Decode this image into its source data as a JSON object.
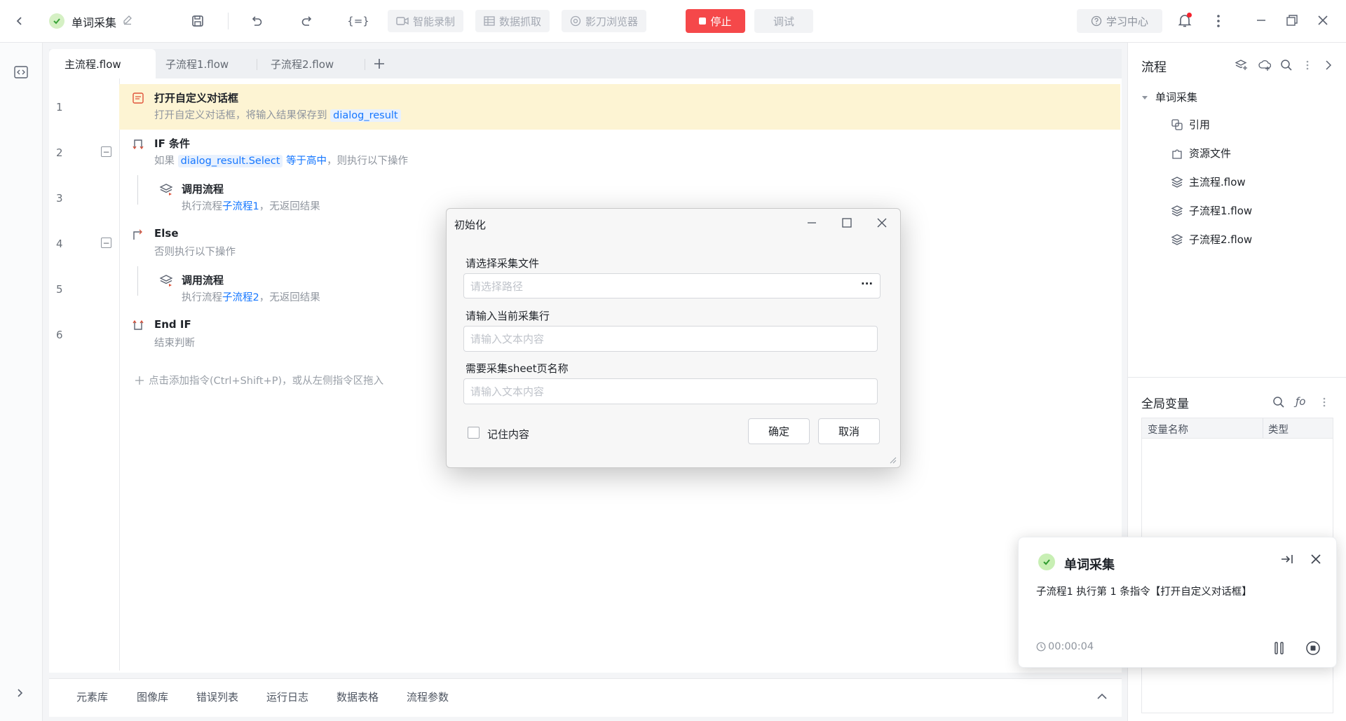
{
  "toolbar": {
    "project_name": "单词采集",
    "smart_record": "智能录制",
    "data_capture": "数据抓取",
    "browser": "影刀浏览器",
    "stop": "停止",
    "debug": "调试",
    "help_center": "学习中心"
  },
  "tabs": [
    {
      "label": "主流程.flow"
    },
    {
      "label": "子流程1.flow"
    },
    {
      "label": "子流程2.flow"
    }
  ],
  "steps": [
    {
      "line": "1",
      "title": "打开自定义对话框",
      "desc_prefix": "打开自定义对话框，将输入结果保存到",
      "var": "dialog_result"
    },
    {
      "line": "2",
      "title": "IF 条件",
      "desc_prefix": "如果",
      "var": "dialog_result.Select",
      "desc_mid": "等于高中",
      "desc_suffix": "，则执行以下操作"
    },
    {
      "line": "3",
      "title": "调用流程",
      "desc_prefix": "执行流程",
      "link": "子流程1",
      "desc_suffix": "，无返回结果"
    },
    {
      "line": "4",
      "title": "Else",
      "desc": "否则执行以下操作"
    },
    {
      "line": "5",
      "title": "调用流程",
      "desc_prefix": "执行流程",
      "link": "子流程2",
      "desc_suffix": "，无返回结果"
    },
    {
      "line": "6",
      "title": "End IF",
      "desc": "结束判断"
    }
  ],
  "add_hint": "点击添加指令(Ctrl+Shift+P)，或从左侧指令区拖入",
  "bottom_tabs": [
    "元素库",
    "图像库",
    "错误列表",
    "运行日志",
    "数据表格",
    "流程参数"
  ],
  "right_panel": {
    "title": "流程",
    "tree_root": "单词采集",
    "tree_items": [
      "引用",
      "资源文件",
      "主流程.flow",
      "子流程1.flow",
      "子流程2.flow"
    ],
    "vars_title": "全局变量",
    "vars_headers": [
      "变量名称",
      "类型"
    ]
  },
  "dialog": {
    "title": "初始化",
    "field1_label": "请选择采集文件",
    "field1_placeholder": "请选择路径",
    "field1_button": "···",
    "field2_label": "请输入当前采集行",
    "field2_placeholder": "请输入文本内容",
    "field3_label": "需要采集sheet页名称",
    "field3_placeholder": "请输入文本内容",
    "remember_label": "记住内容",
    "remember_checked": false,
    "ok": "确定",
    "cancel": "取消"
  },
  "notification": {
    "title": "单词采集",
    "message": "子流程1 执行第 1 条指令【打开自定义对话框】",
    "timer": "00:00:04"
  },
  "colors": {
    "accent": "#1677ff",
    "stop": "#f5484a",
    "highlight_row": "#fdf4d3",
    "success": "#52c41a"
  }
}
